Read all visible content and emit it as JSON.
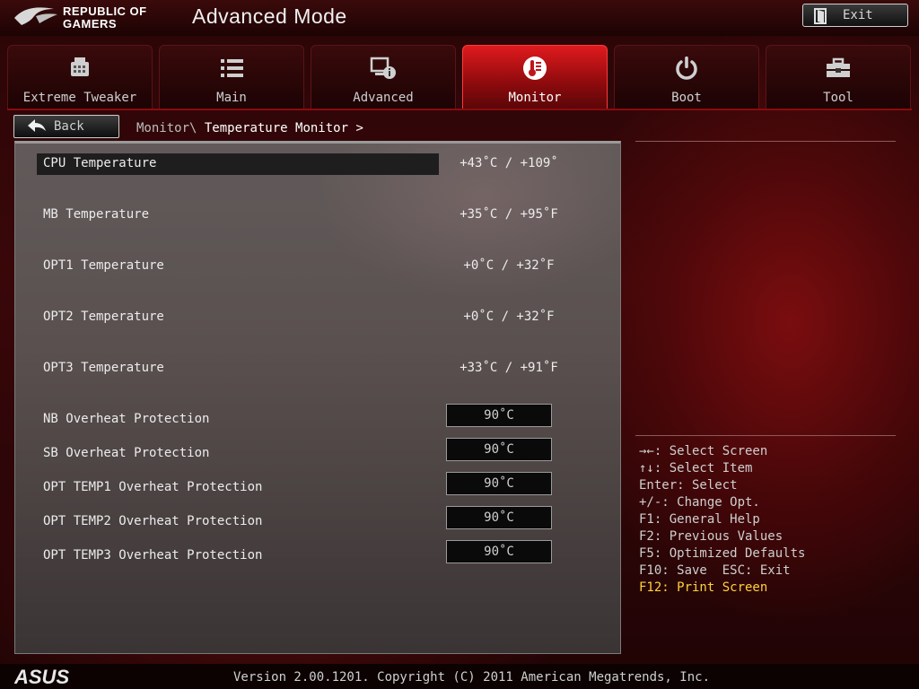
{
  "header": {
    "brand_line1": "REPUBLIC OF",
    "brand_line2": "GAMERS",
    "title": "Advanced Mode",
    "exit_label": "Exit"
  },
  "tabs": [
    {
      "label": "Extreme Tweaker",
      "icon": "tweaker-icon"
    },
    {
      "label": "Main",
      "icon": "list-icon"
    },
    {
      "label": "Advanced",
      "icon": "advanced-settings-icon"
    },
    {
      "label": "Monitor",
      "icon": "thermometer-icon",
      "active": true
    },
    {
      "label": "Boot",
      "icon": "power-icon"
    },
    {
      "label": "Tool",
      "icon": "toolbox-icon"
    }
  ],
  "nav": {
    "back_label": "Back",
    "breadcrumb_parent": "Monitor\\",
    "breadcrumb_current": " Temperature Monitor >"
  },
  "readings": [
    {
      "name": "CPU Temperature",
      "value": "+43˚C / +109˚"
    },
    {
      "name": "MB Temperature",
      "value": "+35˚C / +95˚F"
    },
    {
      "name": "OPT1 Temperature",
      "value": "+0˚C / +32˚F"
    },
    {
      "name": "OPT2 Temperature",
      "value": "+0˚C / +32˚F"
    },
    {
      "name": "OPT3 Temperature",
      "value": "+33˚C / +91˚F"
    }
  ],
  "protections": [
    {
      "name": "NB Overheat Protection",
      "value": "90˚C"
    },
    {
      "name": "SB Overheat Protection",
      "value": "90˚C"
    },
    {
      "name": "OPT TEMP1 Overheat Protection",
      "value": "90˚C"
    },
    {
      "name": "OPT TEMP2 Overheat Protection",
      "value": "90˚C"
    },
    {
      "name": "OPT TEMP3 Overheat Protection",
      "value": "90˚C"
    }
  ],
  "help": [
    "→←: Select Screen",
    "↑↓: Select Item",
    "Enter: Select",
    "+/-: Change Opt.",
    "F1: General Help",
    "F2: Previous Values",
    "F5: Optimized Defaults",
    "F10: Save  ESC: Exit",
    "F12: Print Screen"
  ],
  "footer": {
    "brand": "ASUS",
    "version": "Version 2.00.1201. Copyright (C) 2011 American Megatrends, Inc."
  },
  "colors": {
    "accent_red": "#e01a1e",
    "highlight_yellow": "#ffd23a",
    "panel_bg": "#5a5050"
  }
}
